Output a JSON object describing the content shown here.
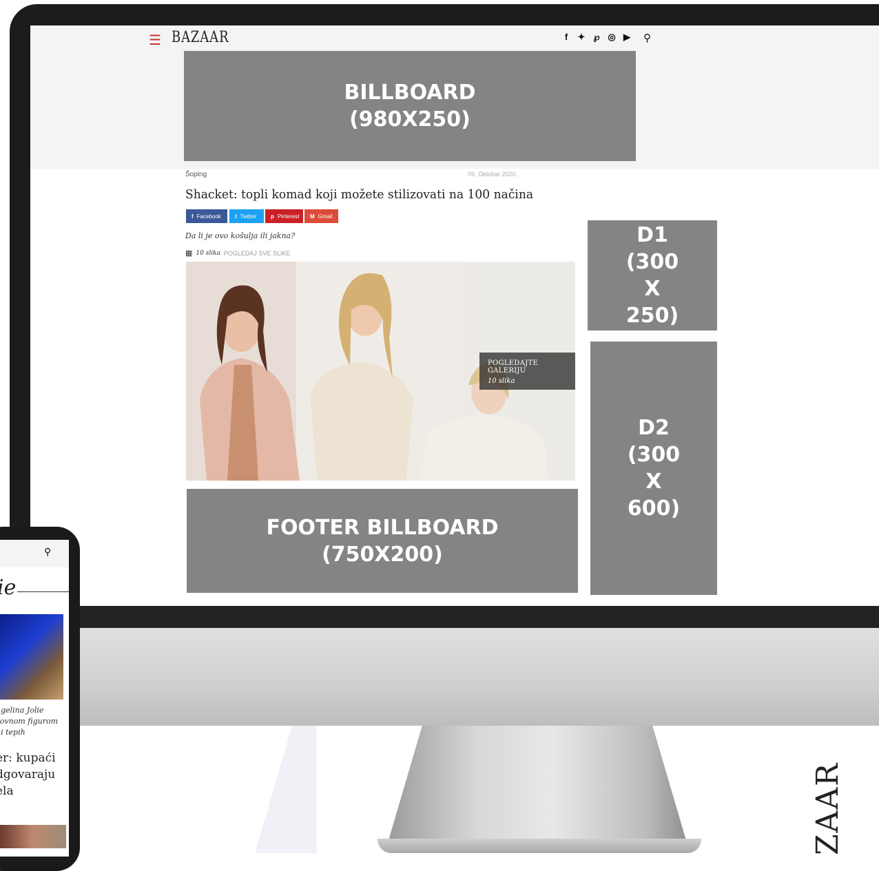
{
  "header": {
    "menu_icon": "hamburger-icon",
    "logo": "BAZAAR",
    "social_icons": [
      "facebook-icon",
      "twitter-icon",
      "pinterest-icon",
      "instagram-icon",
      "youtube-icon"
    ],
    "search_icon": "search-icon",
    "accent_color": "#c0342c"
  },
  "ads": {
    "billboard": "BILLBOARD\n(980X250)",
    "d1": "D1\n(300\nX\n250)",
    "d2": "D2\n(300\nX\n600)",
    "footer": "FOOTER BILLBOARD\n(750X200)",
    "color": "#848487"
  },
  "article": {
    "category": "Šoping",
    "date": "09. Oktobar 2020.",
    "title": "Shacket: topli komad koji možete stilizovati na 100 načina",
    "share": [
      {
        "icon": "f",
        "label": "Facebook",
        "color": "#3b5998"
      },
      {
        "icon": "t",
        "label": "Twitter",
        "color": "#1da1f2"
      },
      {
        "icon": "p",
        "label": "Pinterest",
        "color": "#cb2027"
      },
      {
        "icon": "M",
        "label": "Gmail",
        "color": "#dd4b39"
      }
    ],
    "lead": "Da li je ovo košulja ili jakna?",
    "gallery_count": "10 slika",
    "gallery_link": "POGLEDAJ SVE SLIKE",
    "overlay_title": "POGLEDAJTE GALERIJU",
    "overlay_count": "10 slika"
  },
  "phone": {
    "search_icon": "search-icon",
    "script_text": "ie",
    "caption": "ngelina Jolie\nzovnom figurom\nni tepih",
    "headline": "er: kupaći\ndgovaraju\nela"
  },
  "brand_vertical": "ZAAR"
}
